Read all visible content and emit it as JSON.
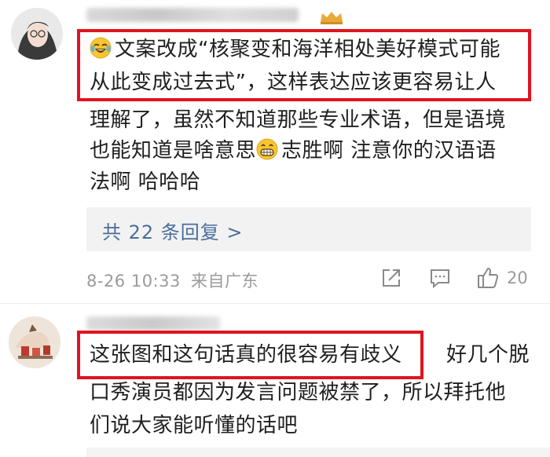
{
  "comment1": {
    "line1_text": "文案改成“核聚变和海洋相处美好模式可能",
    "line2_text": "从此变成过去式”，这样表达应该更容易让人",
    "line3_text": "理解了，虽然不知道那些专业术语，但是语境",
    "line4_before": "也能知道是啥意思",
    "line4_after": "志胜啊 注意你的汉语语",
    "line5_text": "法啊  哈哈哈",
    "reply_link": "共 22 条回复 >",
    "time": "8-26 10:33",
    "source": "来自广东",
    "likes": "20"
  },
  "comment2": {
    "highlight_text": "这张图和这句话真的很容易有歧义",
    "line1_rest": "好几个脱",
    "line2_text": "口秀演员都因为发言问题被禁了，所以拜托他",
    "line3_text": "们说大家能听懂的话吧"
  },
  "colors": {
    "highlight": "#e0141e",
    "link": "#4a6e9c",
    "meta": "#9a9a9a",
    "reply_bg": "#f2f2f2"
  },
  "icons": [
    "laughing-tears-emoji",
    "grinning-emoji",
    "share-icon",
    "comment-icon",
    "thumbs-up-icon",
    "crown-badge-icon"
  ]
}
